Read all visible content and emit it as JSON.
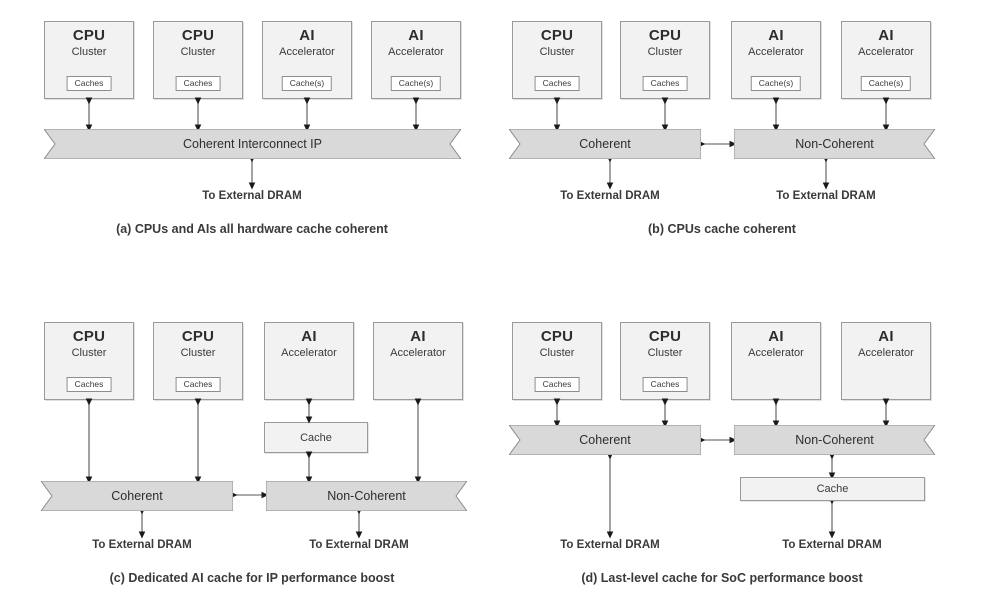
{
  "figure": {
    "background": "#ffffff",
    "block_fill": "#f2f2f2",
    "banner_fill": "#d9d9d9",
    "stroke": "#9a9a9a",
    "text_color": "#3a3a3a"
  },
  "labels": {
    "cpu_title": "CPU",
    "cpu_sub": "Cluster",
    "ai_title": "AI",
    "ai_sub": "Accelerator",
    "cpu_cache": "Caches",
    "ai_cache": "Cache(s)",
    "cache": "Cache",
    "dram": "To External DRAM",
    "coherent_interconnect": "Coherent Interconnect IP",
    "coherent": "Coherent",
    "non_coherent": "Non-Coherent"
  },
  "panels": [
    {
      "id": "a",
      "caption": "(a) CPUs and AIs all hardware cache coherent",
      "blocks": [
        {
          "title": "CPU",
          "sub": "Cluster",
          "cache": "Caches"
        },
        {
          "title": "CPU",
          "sub": "Cluster",
          "cache": "Caches"
        },
        {
          "title": "AI",
          "sub": "Accelerator",
          "cache": "Cache(s)"
        },
        {
          "title": "AI",
          "sub": "Accelerator",
          "cache": "Cache(s)"
        }
      ],
      "banners": [
        {
          "label": "Coherent Interconnect IP"
        }
      ],
      "dram_labels": [
        "To External DRAM"
      ]
    },
    {
      "id": "b",
      "caption": "(b) CPUs cache coherent",
      "blocks": [
        {
          "title": "CPU",
          "sub": "Cluster",
          "cache": "Caches"
        },
        {
          "title": "CPU",
          "sub": "Cluster",
          "cache": "Caches"
        },
        {
          "title": "AI",
          "sub": "Accelerator",
          "cache": "Cache(s)"
        },
        {
          "title": "AI",
          "sub": "Accelerator",
          "cache": "Cache(s)"
        }
      ],
      "banners": [
        {
          "label": "Coherent"
        },
        {
          "label": "Non-Coherent"
        }
      ],
      "dram_labels": [
        "To External DRAM",
        "To External DRAM"
      ]
    },
    {
      "id": "c",
      "caption": "(c) Dedicated AI cache for IP performance boost",
      "blocks": [
        {
          "title": "CPU",
          "sub": "Cluster",
          "cache": "Caches"
        },
        {
          "title": "CPU",
          "sub": "Cluster",
          "cache": "Caches"
        },
        {
          "title": "AI",
          "sub": "Accelerator",
          "cache": null
        },
        {
          "title": "AI",
          "sub": "Accelerator",
          "cache": null
        }
      ],
      "extra_caches": [
        {
          "label": "Cache"
        }
      ],
      "banners": [
        {
          "label": "Coherent"
        },
        {
          "label": "Non-Coherent"
        }
      ],
      "dram_labels": [
        "To External DRAM",
        "To External DRAM"
      ]
    },
    {
      "id": "d",
      "caption": "(d) Last-level cache for SoC performance boost",
      "blocks": [
        {
          "title": "CPU",
          "sub": "Cluster",
          "cache": "Caches"
        },
        {
          "title": "CPU",
          "sub": "Cluster",
          "cache": "Caches"
        },
        {
          "title": "AI",
          "sub": "Accelerator",
          "cache": null
        },
        {
          "title": "AI",
          "sub": "Accelerator",
          "cache": null
        }
      ],
      "extra_caches": [
        {
          "label": "Cache"
        }
      ],
      "banners": [
        {
          "label": "Coherent"
        },
        {
          "label": "Non-Coherent"
        }
      ],
      "dram_labels": [
        "To External DRAM",
        "To External DRAM"
      ]
    }
  ]
}
